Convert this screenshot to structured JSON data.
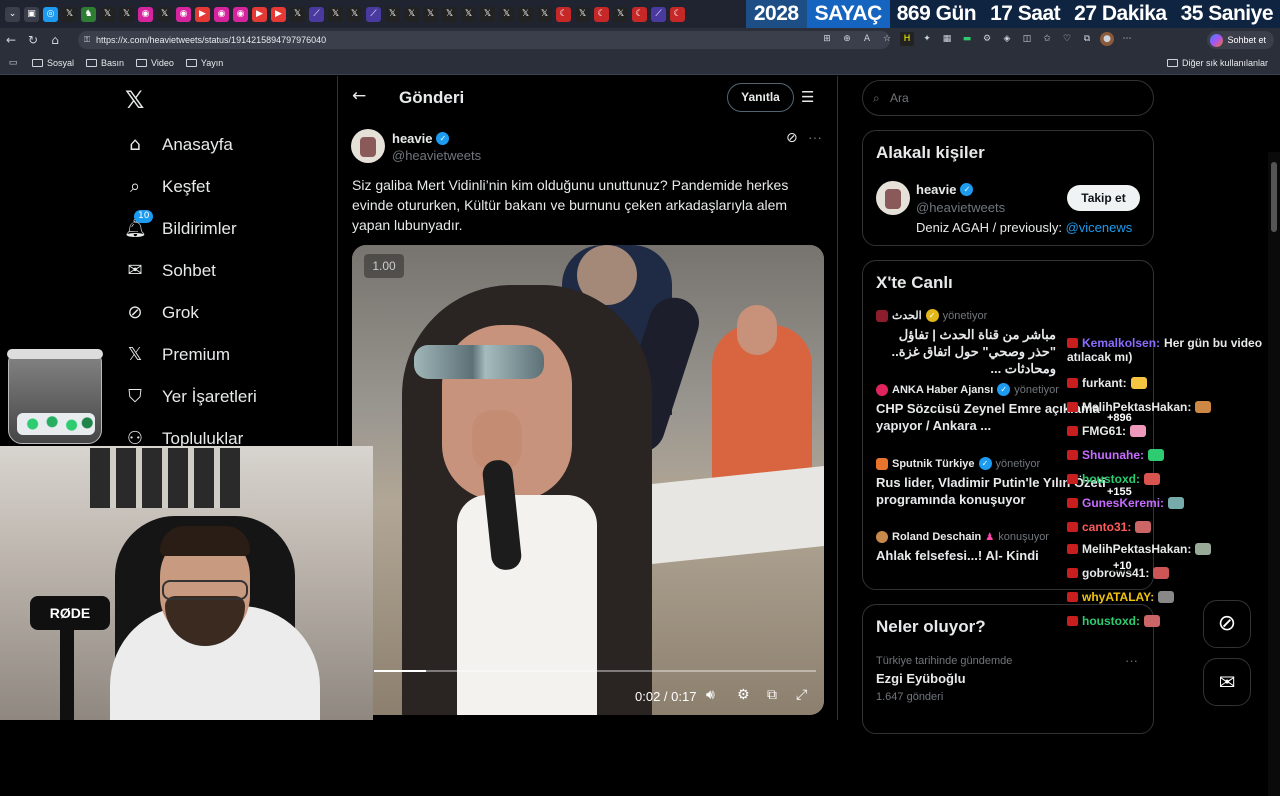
{
  "browser": {
    "counter": {
      "year": "2028",
      "label": "SAYAÇ",
      "days": "869 Gün",
      "hours": "17 Saat",
      "minutes": "27 Dakika",
      "seconds": "35 Saniye"
    },
    "url": "https://x.com/heavietweets/status/1914215894797976040",
    "copilot_label": "Sohbet et",
    "bookmarks": [
      "Sosyal",
      "Basın",
      "Video",
      "Yayın"
    ],
    "other_bookmarks": "Diğer sık kullanılanlar"
  },
  "sidebar": {
    "items": [
      {
        "label": "Anasayfa",
        "icon": "home-icon"
      },
      {
        "label": "Keşfet",
        "icon": "search-icon"
      },
      {
        "label": "Bildirimler",
        "icon": "bell-icon",
        "badge": "10"
      },
      {
        "label": "Sohbet",
        "icon": "mail-icon"
      },
      {
        "label": "Grok",
        "icon": "grok-icon"
      },
      {
        "label": "Premium",
        "icon": "x-icon"
      },
      {
        "label": "Yer İşaretleri",
        "icon": "bookmark-icon"
      },
      {
        "label": "Topluluklar",
        "icon": "people-icon"
      }
    ]
  },
  "post": {
    "page_title": "Gönderi",
    "reply_button": "Yanıtla",
    "author_name": "heavie",
    "author_handle": "@heavietweets",
    "text": "Siz galiba Mert Vidinli’nin kim olduğunu unuttunuz? Pandemide herkes evinde otururken, Kültür bakanı ve burnunu çeken arkadaşlarıyla alem yapan lubunyadır.",
    "video": {
      "speed": "1.00",
      "time": "0:02 / 0:17",
      "progress": 0.118
    }
  },
  "right": {
    "search_placeholder": "Ara",
    "related": {
      "title": "Alakalı kişiler",
      "name": "heavie",
      "handle": "@heavietweets",
      "bio_prefix": "Deniz AGAH / previously: ",
      "bio_link": "@vicenews",
      "follow_button": "Takip et"
    },
    "live": {
      "title": "X'te Canlı",
      "items": [
        {
          "source": "الحدث",
          "status": "yönetiyor",
          "title": "مباشر من قناة الحدث | تفاؤل \"حذر وصحي\" حول اتفاق غزة.. ومحادثات ..."
        },
        {
          "source": "ANKA Haber Ajansı",
          "status": "yönetiyor",
          "title": "CHP Sözcüsü Zeynel Emre açıklama yapıyor / Ankara ..."
        },
        {
          "source": "Sputnik Türkiye",
          "status": "yönetiyor",
          "title": "Rus lider, Vladimir Putin'le Yılın Özeti programında konuşuyor"
        },
        {
          "source": "Roland Deschain",
          "status": "konuşuyor",
          "title": "Ahlak felsefesi...! Al- Kindi"
        }
      ]
    },
    "trends": {
      "title": "Neler oluyor?",
      "context": "Türkiye tarihinde gündemde",
      "name": "Ezgi Eyüboğlu",
      "count": "1.647 gönderi"
    }
  },
  "chat": {
    "messages": [
      {
        "user": "Kemalkolsen:",
        "text": "Her gün bu video",
        "color": "#8a6cff"
      },
      {
        "user": "atılacak mı)",
        "text": "",
        "color": "#e7e9ea"
      },
      {
        "user": "furkant:",
        "text": "",
        "color": "#e7e9ea"
      },
      {
        "user": "MelihPektasHakan:",
        "text": "",
        "color": "#e7e9ea"
      },
      {
        "user": "FMG61:",
        "text": "",
        "color": "#e7e9ea"
      },
      {
        "user": "Shuunahe:",
        "text": "",
        "color": "#c66cff"
      },
      {
        "user": "houstoxd:",
        "text": "",
        "color": "#2ecc71"
      },
      {
        "user": "GunesKeremi:",
        "text": "",
        "color": "#c66cff"
      },
      {
        "user": "canto31:",
        "text": "",
        "color": "#ff5c5c"
      },
      {
        "user": "MelihPektasHakan:",
        "text": "",
        "color": "#e7e9ea"
      },
      {
        "user": "gobrows41:",
        "text": "",
        "color": "#e7e9ea"
      },
      {
        "user": "whyATALAY:",
        "text": "",
        "color": "#f1c40f"
      },
      {
        "user": "houstoxd:",
        "text": "",
        "color": "#2ecc71"
      }
    ],
    "counters": [
      "+896",
      "+155",
      "+10"
    ]
  }
}
